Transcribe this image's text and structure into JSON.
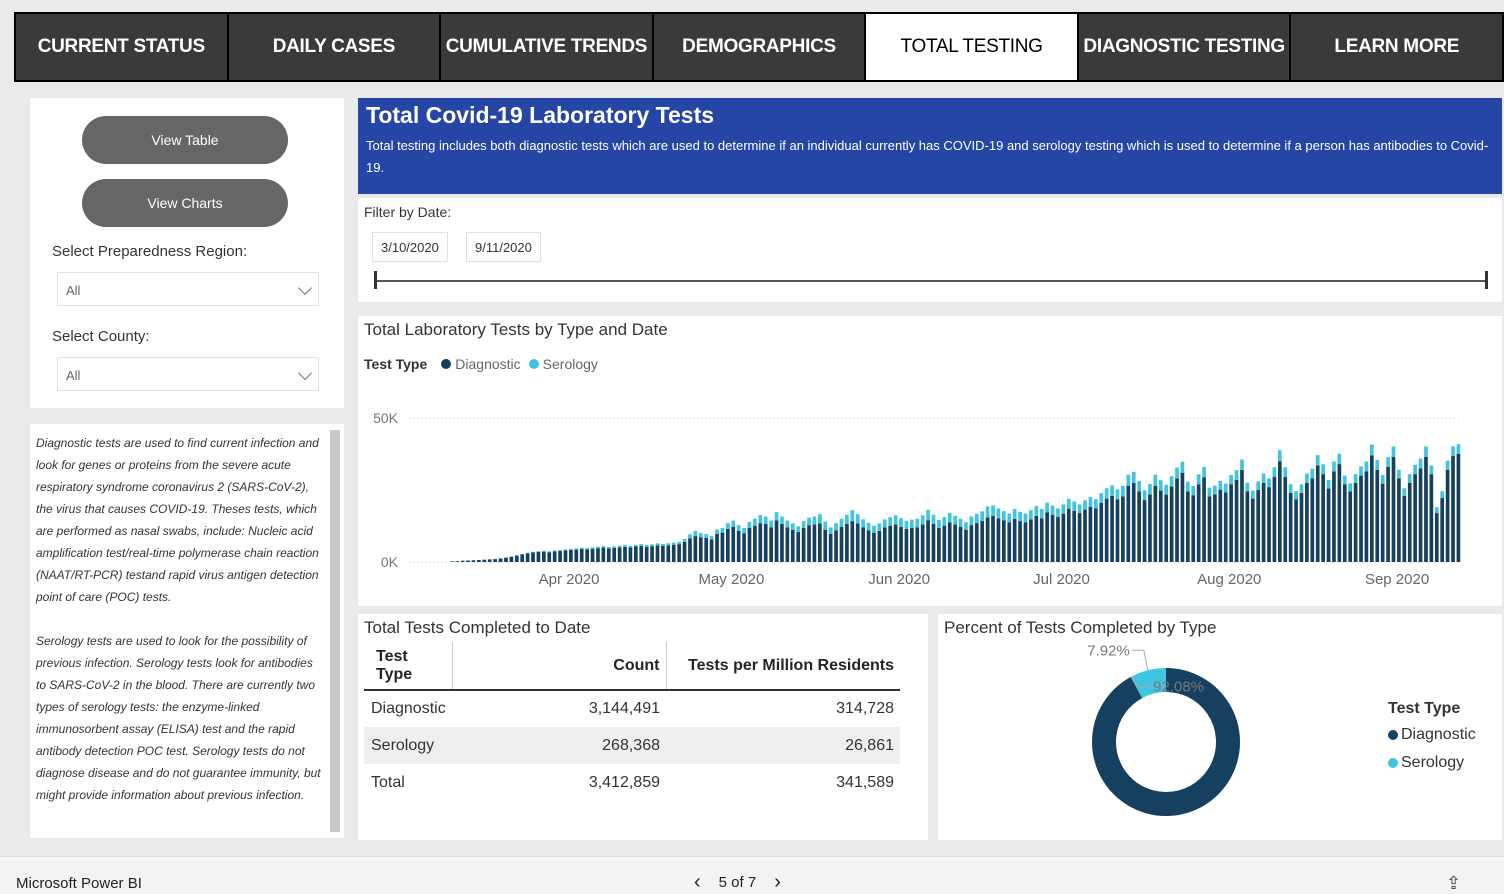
{
  "tabs": [
    {
      "label": "CURRENT STATUS",
      "active": false
    },
    {
      "label": "DAILY CASES",
      "active": false
    },
    {
      "label": "CUMULATIVE TRENDS",
      "active": false
    },
    {
      "label": "DEMOGRAPHICS",
      "active": false
    },
    {
      "label": "TOTAL TESTING",
      "active": true
    },
    {
      "label": "DIAGNOSTIC TESTING",
      "active": false
    },
    {
      "label": "LEARN MORE",
      "active": false
    }
  ],
  "sidebar": {
    "view_table": "View Table",
    "view_charts": "View Charts",
    "region_label": "Select Preparedness Region:",
    "region_value": "All",
    "county_label": "Select County:",
    "county_value": "All",
    "info_p1": "Diagnostic tests are used to find current infection and look for genes or proteins from the severe acute respiratory syndrome coronavirus 2 (SARS-CoV-2), the virus that causes COVID-19. Theses tests, which are performed as nasal swabs, include: Nucleic acid amplification test/real-time polymerase chain reaction (NAAT/RT-PCR) testand rapid virus antigen detection point of care (POC) tests.",
    "info_p2": "Serology tests are used to look for the possibility of previous infection. Serology tests look for antibodies to SARS-CoV-2 in the blood. There are currently two types of serology tests: the enzyme-linked immunosorbent assay (ELISA) test and the rapid antibody detection POC test. Serology tests do not diagnose disease and do not guarantee immunity, but might provide information about previous infection."
  },
  "header": {
    "title": "Total Covid-19 Laboratory Tests",
    "description": "Total testing includes both diagnostic tests which are used to determine if an individual currently has COVID-19 and serology testing which is used to determine if a person has antibodies to Covid-19."
  },
  "filter": {
    "label": "Filter by Date:",
    "start": "3/10/2020",
    "end": "9/11/2020"
  },
  "chart_data": [
    {
      "type": "bar",
      "stacked": true,
      "title": "Total Laboratory Tests by Type and Date",
      "legend_title": "Test Type",
      "ylim": [
        0,
        50000
      ],
      "yticks": [
        "0K",
        "50K"
      ],
      "xticks": [
        "Apr 2020",
        "May 2020",
        "Jun 2020",
        "Jul 2020",
        "Aug 2020",
        "Sep 2020"
      ],
      "series": [
        {
          "name": "Diagnostic",
          "color": "#16405f",
          "values": [
            200,
            300,
            450,
            500,
            600,
            700,
            800,
            900,
            1000,
            1200,
            1500,
            1800,
            2200,
            2600,
            3000,
            3300,
            3500,
            3600,
            3400,
            3700,
            3800,
            4000,
            4200,
            4300,
            4500,
            4400,
            4600,
            4800,
            5000,
            4700,
            4900,
            5100,
            5300,
            5100,
            5400,
            5600,
            5300,
            5500,
            5800,
            5600,
            5800,
            6000,
            6200,
            7000,
            8200,
            9000,
            8600,
            8400,
            7800,
            9800,
            10200,
            11500,
            12200,
            10800,
            10000,
            11800,
            12600,
            13500,
            13200,
            12000,
            14500,
            13200,
            12000,
            11200,
            10400,
            11800,
            12800,
            13000,
            13400,
            11200,
            9800,
            11000,
            12200,
            13200,
            14200,
            13400,
            12000,
            11000,
            10200,
            10800,
            12000,
            12600,
            13000,
            12200,
            11500,
            11800,
            12000,
            13000,
            14500,
            13200,
            11800,
            12600,
            13800,
            13000,
            12200,
            11200,
            12800,
            13500,
            14200,
            15500,
            16000,
            15200,
            14500,
            13800,
            15000,
            14200,
            13800,
            14800,
            16000,
            15200,
            17200,
            16400,
            15600,
            16800,
            18500,
            17800,
            17000,
            18200,
            19200,
            18600,
            20500,
            22000,
            23000,
            21800,
            22800,
            26500,
            27500,
            24500,
            21500,
            23500,
            26500,
            24800,
            23400,
            26200,
            29000,
            31000,
            24500,
            23200,
            27000,
            29400,
            22800,
            23500,
            25000,
            24200,
            27000,
            28500,
            32000,
            24500,
            22000,
            25000,
            27500,
            26000,
            29500,
            35000,
            29500,
            24000,
            21800,
            24000,
            27500,
            29000,
            33500,
            30500,
            25500,
            31500,
            34000,
            27000,
            24500,
            27500,
            30000,
            31500,
            37000,
            32000,
            27200,
            33000,
            36500,
            29000,
            23000,
            27500,
            30500,
            32500,
            36500,
            30500,
            17000,
            22200,
            32000,
            36800,
            37500
          ]
        },
        {
          "name": "Serology",
          "color": "#41c4e0",
          "values": [
            0,
            0,
            0,
            0,
            0,
            0,
            0,
            50,
            80,
            100,
            120,
            150,
            180,
            200,
            220,
            250,
            280,
            300,
            300,
            320,
            350,
            380,
            400,
            420,
            450,
            450,
            480,
            500,
            520,
            500,
            520,
            550,
            580,
            550,
            580,
            620,
            600,
            650,
            700,
            680,
            700,
            750,
            800,
            1000,
            1400,
            1800,
            1500,
            1300,
            1200,
            1500,
            1600,
            2000,
            2200,
            2000,
            1800,
            2100,
            2400,
            2800,
            2600,
            2400,
            2800,
            2600,
            2400,
            2200,
            2000,
            2400,
            2600,
            2800,
            3200,
            2800,
            2200,
            2500,
            2800,
            3200,
            3800,
            3200,
            2800,
            2600,
            2400,
            2600,
            2800,
            3000,
            3200,
            3000,
            2800,
            2900,
            3000,
            3200,
            3600,
            3200,
            2800,
            3000,
            3200,
            3000,
            2800,
            2600,
            3000,
            3200,
            3400,
            3800,
            3600,
            3400,
            3200,
            3000,
            3400,
            3200,
            3000,
            3200,
            3400,
            3200,
            3400,
            3200,
            3000,
            3200,
            3400,
            3200,
            3000,
            3200,
            3400,
            3200,
            3400,
            3600,
            3600,
            3400,
            3600,
            3800,
            3800,
            3600,
            3400,
            3600,
            3800,
            3600,
            3400,
            3600,
            3800,
            3800,
            3400,
            3200,
            3400,
            3600,
            3000,
            3000,
            3200,
            3000,
            3200,
            3400,
            3600,
            3000,
            2800,
            3000,
            3200,
            3000,
            3400,
            3800,
            3400,
            3000,
            2800,
            3000,
            3200,
            3400,
            3600,
            3400,
            3000,
            3400,
            3600,
            3000,
            2800,
            3000,
            3200,
            3400,
            3800,
            3400,
            3000,
            3400,
            3600,
            3000,
            2600,
            3000,
            3200,
            3400,
            3600,
            3000,
            2000,
            2400,
            3200,
            3400,
            3400
          ]
        }
      ]
    },
    {
      "type": "table",
      "title": "Total Tests Completed to Date",
      "columns": [
        "Test Type",
        "Count",
        "Tests per Million Residents"
      ],
      "rows": [
        [
          "Diagnostic",
          "3,144,491",
          "314,728"
        ],
        [
          "Serology",
          "268,368",
          "26,861"
        ],
        [
          "Total",
          "3,412,859",
          "341,589"
        ]
      ]
    },
    {
      "type": "pie",
      "donut": true,
      "title": "Percent of Tests Completed by Type",
      "legend_title": "Test Type",
      "labels": [
        "Diagnostic",
        "Serology"
      ],
      "values": [
        92.08,
        7.92
      ],
      "value_labels": [
        "92.08%",
        "7.92%"
      ],
      "colors": [
        "#16405f",
        "#41c4e0"
      ]
    }
  ],
  "footer": {
    "brand": "Microsoft Power BI",
    "page": "5 of 7",
    "prev_icon": "chevron-left-icon",
    "next_icon": "chevron-right-icon",
    "share_icon": "share-icon"
  }
}
